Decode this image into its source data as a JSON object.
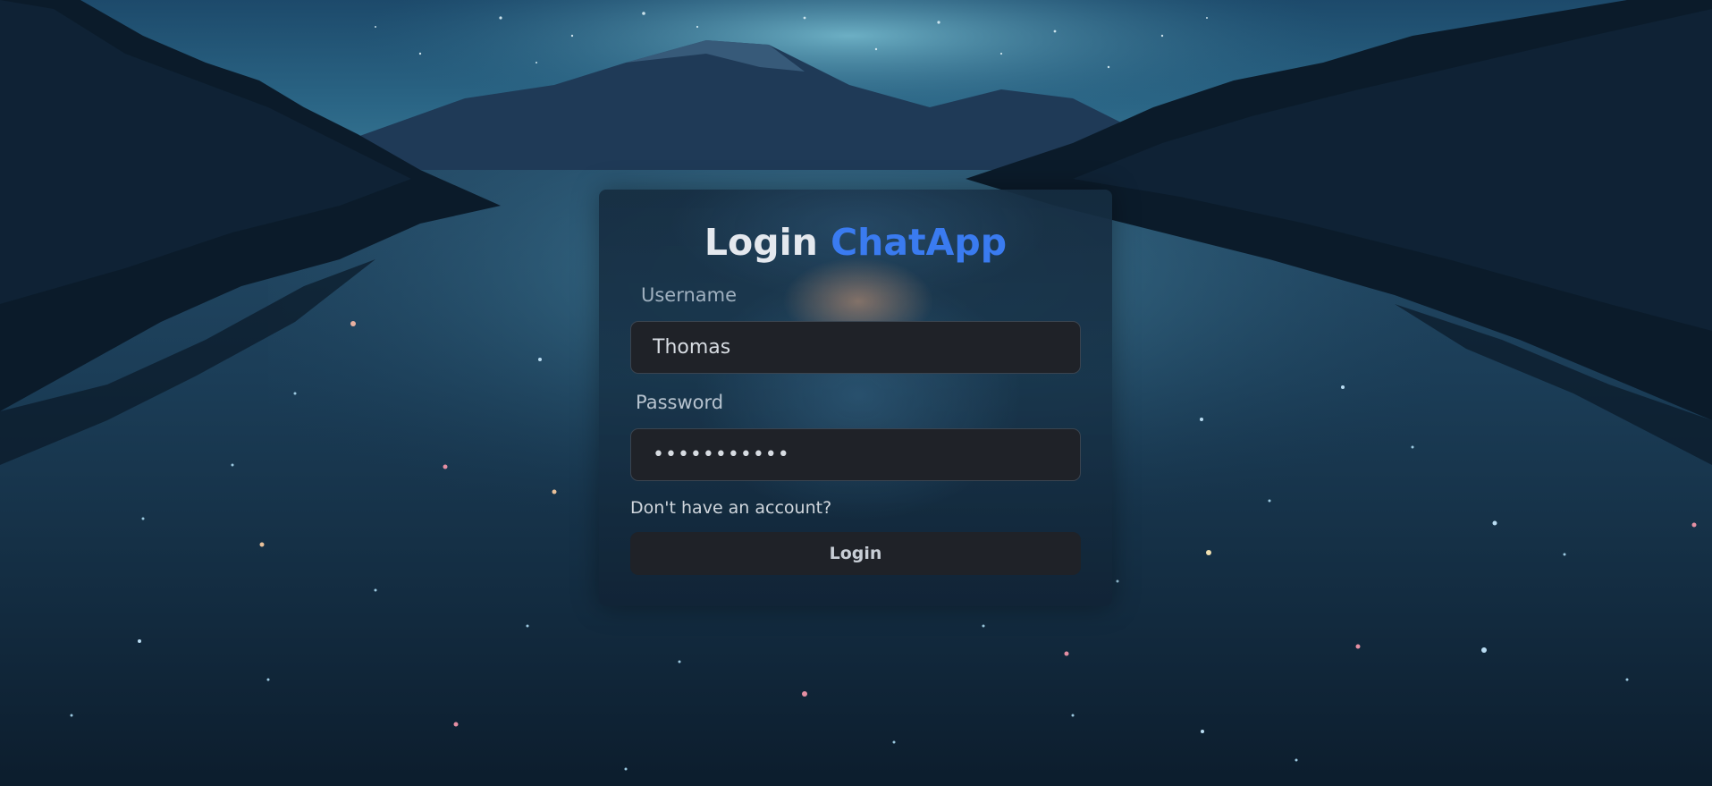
{
  "login_form": {
    "title_prefix": "Login",
    "title_brand": "ChatApp",
    "username_label": "Username",
    "username_value": "Thomas",
    "password_label": "Password",
    "password_value": "•••••••••••",
    "signup_link": "Don't have an account?",
    "login_button": "Login"
  },
  "colors": {
    "brand": "#3a7bf0",
    "input_background": "#1f2228",
    "title_text": "#e4e8ee"
  }
}
